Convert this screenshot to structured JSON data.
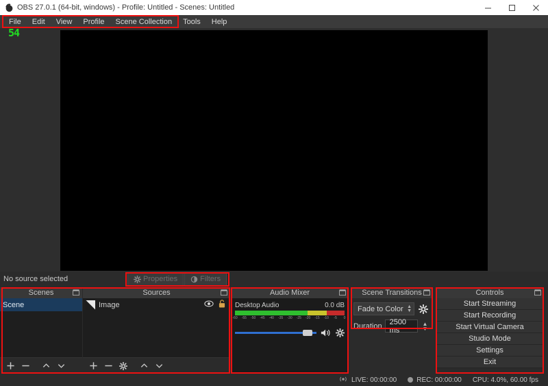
{
  "window": {
    "title": "OBS 27.0.1 (64-bit, windows) - Profile: Untitled - Scenes: Untitled",
    "minimize_label": "minimize-icon",
    "maximize_label": "maximize-icon",
    "close_label": "close-icon"
  },
  "menubar": {
    "items": [
      {
        "label": "File"
      },
      {
        "label": "Edit"
      },
      {
        "label": "View"
      },
      {
        "label": "Profile"
      },
      {
        "label": "Scene Collection"
      },
      {
        "label": "Tools"
      },
      {
        "label": "Help"
      }
    ]
  },
  "overlay": {
    "fps_counter": "54"
  },
  "source_toolbar": {
    "status_text": "No source selected",
    "properties_label": "Properties",
    "filters_label": "Filters"
  },
  "scenes": {
    "title": "Scenes",
    "items": [
      {
        "label": "Scene",
        "selected": true
      }
    ],
    "toolbar": {
      "add": "+",
      "remove": "−",
      "up": "˄",
      "down": "˅"
    }
  },
  "sources": {
    "title": "Sources",
    "items": [
      {
        "label": "Image",
        "visible": true,
        "locked": false
      }
    ],
    "toolbar": {
      "add": "+",
      "remove": "−",
      "properties": "gear-icon",
      "up": "˄",
      "down": "˅"
    }
  },
  "audio_mixer": {
    "title": "Audio Mixer",
    "channels": [
      {
        "name": "Desktop Audio",
        "level_db": "0.0 dB",
        "volume_percent": 83,
        "muted": false
      }
    ],
    "scale_ticks": [
      "-60",
      "-55",
      "-50",
      "-45",
      "-40",
      "-35",
      "-30",
      "-25",
      "-20",
      "-15",
      "-10",
      "-5",
      "0"
    ]
  },
  "scene_transitions": {
    "title": "Scene Transitions",
    "transition": "Fade to Color",
    "duration_label": "Duration",
    "duration_value": "2500 ms"
  },
  "controls": {
    "title": "Controls",
    "buttons": [
      {
        "label": "Start Streaming"
      },
      {
        "label": "Start Recording"
      },
      {
        "label": "Start Virtual Camera"
      },
      {
        "label": "Studio Mode"
      },
      {
        "label": "Settings"
      },
      {
        "label": "Exit"
      }
    ]
  },
  "statusbar": {
    "live_label": "LIVE: 00:00:00",
    "rec_label": "REC: 00:00:00",
    "cpu_label": "CPU: 4.0%, 60.00 fps"
  },
  "colors": {
    "accent_blue": "#2f6fd0",
    "selection_blue": "#1b3b5c",
    "annotation_red": "#ee1111",
    "meter_green": "#2fbf2f",
    "meter_yellow": "#c9c42c",
    "meter_red": "#c62b2b",
    "fps_green": "#22dd22"
  }
}
